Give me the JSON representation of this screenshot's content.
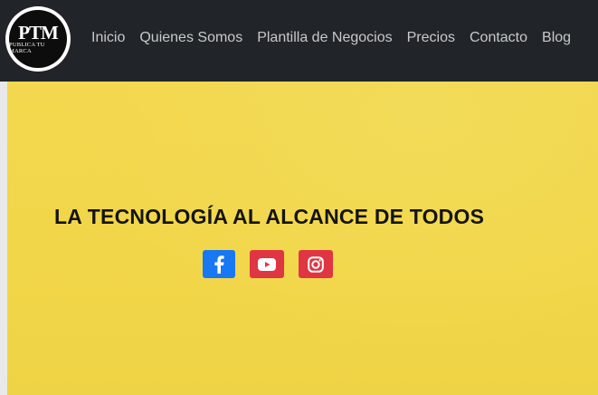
{
  "logo": {
    "initials": "PTM",
    "tagline": "PUBLICA TU MARCA"
  },
  "nav": {
    "items": [
      {
        "label": "Inicio"
      },
      {
        "label": "Quienes Somos"
      },
      {
        "label": "Plantilla de Negocios"
      },
      {
        "label": "Precios"
      },
      {
        "label": "Contacto"
      },
      {
        "label": "Blog"
      }
    ]
  },
  "hero": {
    "title": "LA TECNOLOGÍA AL ALCANCE DE TODOS",
    "background_color": "#f2d548"
  },
  "social": [
    {
      "name": "facebook",
      "icon": "facebook-icon",
      "color": "#1877f2"
    },
    {
      "name": "youtube",
      "icon": "youtube-icon",
      "color": "#e03542"
    },
    {
      "name": "instagram",
      "icon": "instagram-icon",
      "color": "#e03542"
    }
  ],
  "colors": {
    "navbar": "#212529",
    "nav_text": "#c8c9ca"
  }
}
